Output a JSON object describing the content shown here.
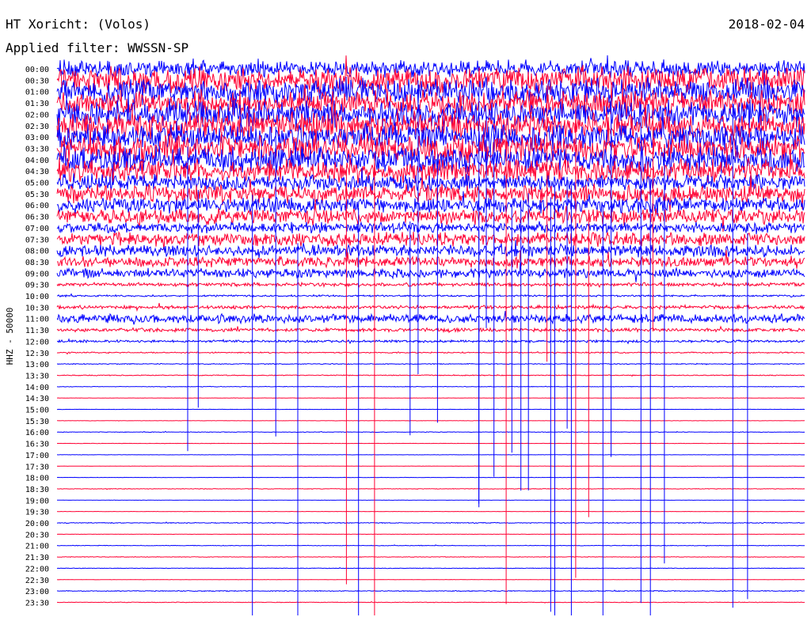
{
  "header": {
    "station": "HT Xoricht: (Volos)",
    "date": "2018-02-04",
    "filter": "Applied filter: WWSSN-SP"
  },
  "chart_data": {
    "type": "helicorder",
    "ylabel": "HHZ - 50000",
    "colors": {
      "a": "#0000ff",
      "b": "#ff0033"
    },
    "rows": [
      {
        "time": "00:00",
        "color": "a",
        "activity": 0.55
      },
      {
        "time": "00:30",
        "color": "b",
        "activity": 0.85
      },
      {
        "time": "01:00",
        "color": "a",
        "activity": 0.85
      },
      {
        "time": "01:30",
        "color": "b",
        "activity": 0.85
      },
      {
        "time": "02:00",
        "color": "a",
        "activity": 0.9
      },
      {
        "time": "02:30",
        "color": "b",
        "activity": 0.9
      },
      {
        "time": "03:00",
        "color": "a",
        "activity": 0.9
      },
      {
        "time": "03:30",
        "color": "b",
        "activity": 0.9
      },
      {
        "time": "04:00",
        "color": "a",
        "activity": 0.85
      },
      {
        "time": "04:30",
        "color": "b",
        "activity": 0.75
      },
      {
        "time": "05:00",
        "color": "a",
        "activity": 0.55
      },
      {
        "time": "05:30",
        "color": "b",
        "activity": 0.6
      },
      {
        "time": "06:00",
        "color": "a",
        "activity": 0.5
      },
      {
        "time": "06:30",
        "color": "b",
        "activity": 0.5
      },
      {
        "time": "07:00",
        "color": "a",
        "activity": 0.35
      },
      {
        "time": "07:30",
        "color": "b",
        "activity": 0.45
      },
      {
        "time": "08:00",
        "color": "a",
        "activity": 0.4
      },
      {
        "time": "08:30",
        "color": "b",
        "activity": 0.35
      },
      {
        "time": "09:00",
        "color": "a",
        "activity": 0.3
      },
      {
        "time": "09:30",
        "color": "b",
        "activity": 0.12
      },
      {
        "time": "10:00",
        "color": "a",
        "activity": 0.06
      },
      {
        "time": "10:30",
        "color": "b",
        "activity": 0.12
      },
      {
        "time": "11:00",
        "color": "a",
        "activity": 0.3
      },
      {
        "time": "11:30",
        "color": "b",
        "activity": 0.12
      },
      {
        "time": "12:00",
        "color": "a",
        "activity": 0.08
      },
      {
        "time": "12:30",
        "color": "b",
        "activity": 0.04
      },
      {
        "time": "13:00",
        "color": "a",
        "activity": 0.03
      },
      {
        "time": "13:30",
        "color": "b",
        "activity": 0.03
      },
      {
        "time": "14:00",
        "color": "a",
        "activity": 0.02
      },
      {
        "time": "14:30",
        "color": "b",
        "activity": 0.01
      },
      {
        "time": "15:00",
        "color": "a",
        "activity": 0.01
      },
      {
        "time": "15:30",
        "color": "b",
        "activity": 0.01
      },
      {
        "time": "16:00",
        "color": "a",
        "activity": 0.02
      },
      {
        "time": "16:30",
        "color": "b",
        "activity": 0.01
      },
      {
        "time": "17:00",
        "color": "a",
        "activity": 0.01
      },
      {
        "time": "17:30",
        "color": "b",
        "activity": 0.01
      },
      {
        "time": "18:00",
        "color": "a",
        "activity": 0.01
      },
      {
        "time": "18:30",
        "color": "b",
        "activity": 0.02
      },
      {
        "time": "19:00",
        "color": "a",
        "activity": 0.01
      },
      {
        "time": "19:30",
        "color": "b",
        "activity": 0.01
      },
      {
        "time": "20:00",
        "color": "a",
        "activity": 0.03
      },
      {
        "time": "20:30",
        "color": "b",
        "activity": 0.01
      },
      {
        "time": "21:00",
        "color": "a",
        "activity": 0.02
      },
      {
        "time": "21:30",
        "color": "b",
        "activity": 0.02
      },
      {
        "time": "22:00",
        "color": "a",
        "activity": 0.02
      },
      {
        "time": "22:30",
        "color": "b",
        "activity": 0.01
      },
      {
        "time": "23:00",
        "color": "a",
        "activity": 0.03
      },
      {
        "time": "23:30",
        "color": "b",
        "activity": 0.02
      }
    ]
  }
}
